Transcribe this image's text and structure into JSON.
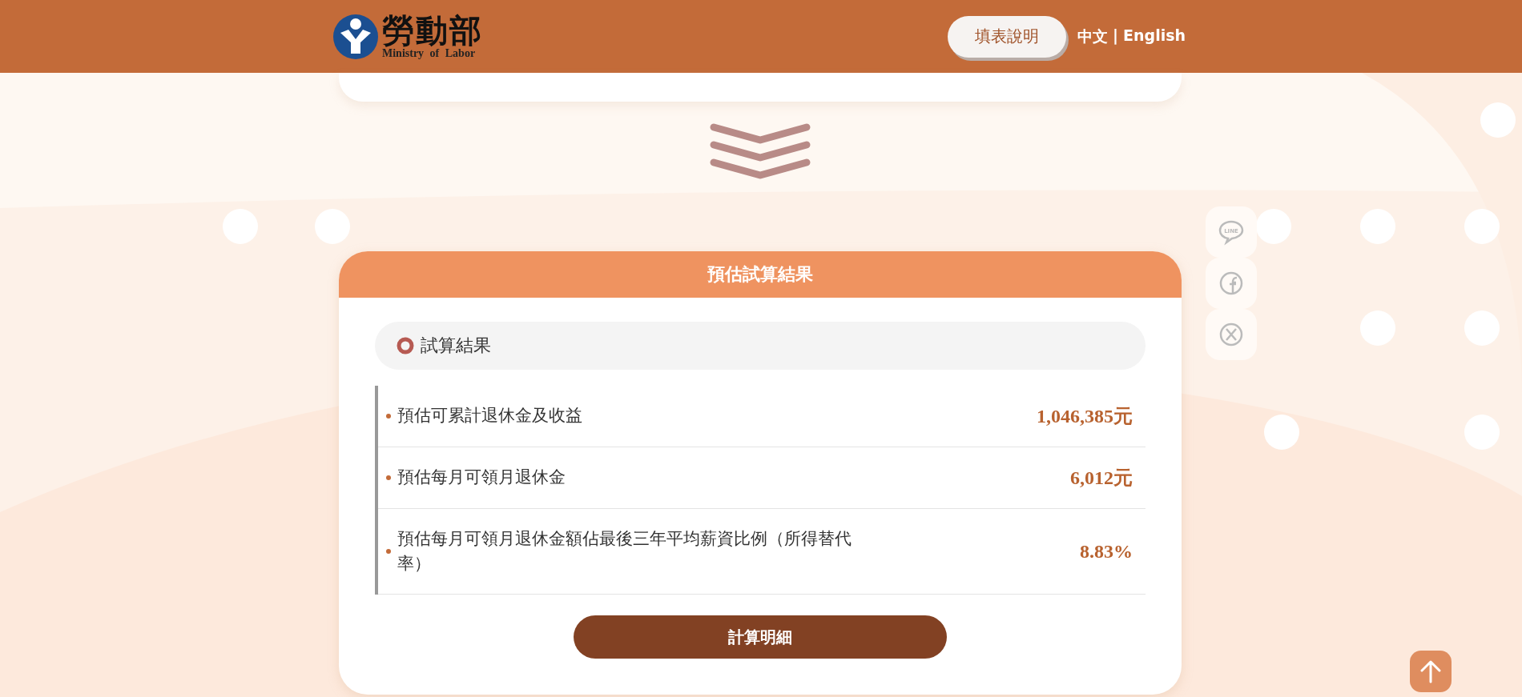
{
  "header": {
    "logo": {
      "title": "勞動部",
      "subtitle": "Ministry of Labor"
    },
    "help_button": "填表說明",
    "language": {
      "chinese": "中文",
      "separator": "|",
      "english": "English"
    }
  },
  "social": [
    {
      "kind": "line",
      "label": "LINE"
    },
    {
      "kind": "facebook"
    },
    {
      "kind": "x"
    }
  ],
  "result_card": {
    "title": "預估試算結果",
    "section": "試算結果",
    "rows": [
      {
        "label": "預估可累計退休金及收益",
        "value": "1,046,385元"
      },
      {
        "label": "預估每月可領月退休金",
        "value": "6,012元"
      },
      {
        "label": "預估每月可領月退休金額佔最後三年平均薪資比例（所得替代率）",
        "value": "8.83%"
      }
    ],
    "detail_button": "計算明細"
  }
}
